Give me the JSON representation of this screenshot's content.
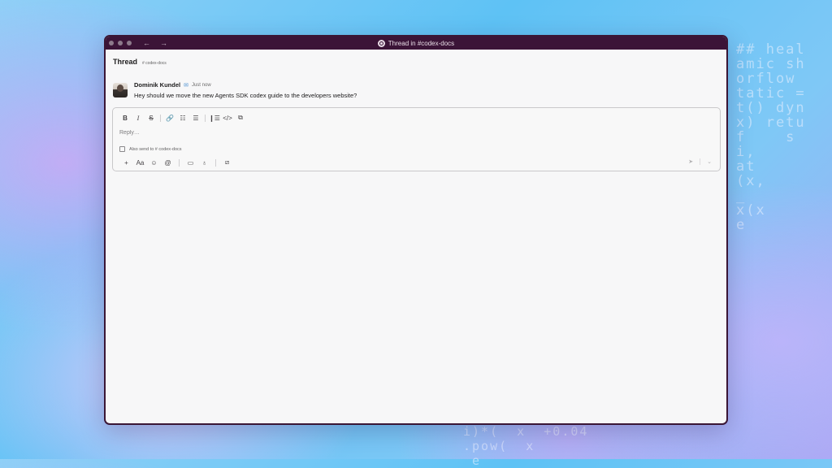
{
  "window": {
    "title": "Thread in #codex-docs",
    "back_label": "←",
    "forward_label": "→"
  },
  "thread": {
    "title": "Thread",
    "channel": "# codex-docs"
  },
  "message": {
    "author": "Dominik Kundel",
    "status_emoji": "✉",
    "time": "Just now",
    "text": "Hey should we move the new Agents SDK codex guide to the developers website?"
  },
  "composer": {
    "placeholder": "Reply…",
    "also_send_label": "Also send to # codex-docs",
    "format_buttons": {
      "bold": "B",
      "italic": "I",
      "strike": "S",
      "link": "🔗",
      "ordered_list": "☷",
      "bullet_list": "☰",
      "blockquote": "❙☰",
      "code": "</>",
      "code_block": "⧉"
    },
    "action_buttons": {
      "add": "+",
      "text_format": "Aa",
      "emoji": "☺",
      "mention": "@",
      "video": "▭",
      "audio": "♁",
      "shortcuts": "⧄"
    },
    "send_icon": "➤",
    "send_options_icon": "⌄"
  },
  "background": {
    "code_right": "## heal\namic sh\norflow\ntatic =\nt() dyn\nx) retu\nf    s    i\ni,\nat\n(x,\n_\nx(x\ne",
    "code_bottom": "i)*(  x  +0.04\n.pow(  x\n e"
  }
}
